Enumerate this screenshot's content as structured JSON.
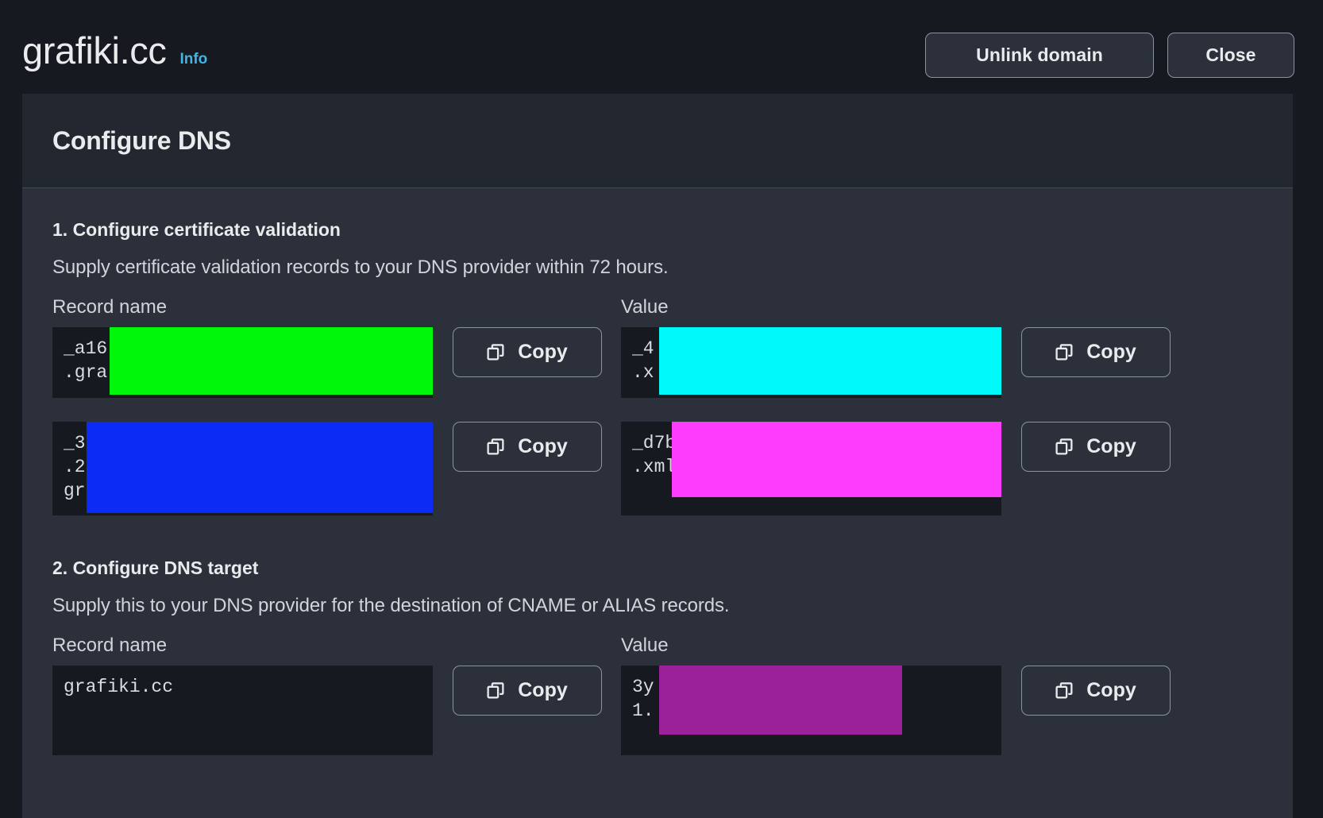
{
  "header": {
    "title": "grafiki.cc",
    "info_label": "Info",
    "unlink_label": "Unlink domain",
    "close_label": "Close"
  },
  "panel": {
    "title": "Configure DNS"
  },
  "labels": {
    "record_name": "Record name",
    "value": "Value",
    "copy": "Copy"
  },
  "colors": {
    "accent_link": "#42b4e6",
    "panel_bg": "#2b303b",
    "panel_header_bg": "#23272f",
    "page_bg": "#16191f",
    "field_bg": "#16191f",
    "button_border": "#8b949e",
    "text": "#e9ebed",
    "redact_green": "#00f707",
    "redact_blue": "#0b2cf5",
    "redact_cyan": "#00f9f9",
    "redact_magenta": "#fd3cfd",
    "redact_purple": "#9a2199"
  },
  "sections": [
    {
      "title": "1. Configure certificate validation",
      "description": "Supply certificate validation records to your DNS provider within 72 hours.",
      "rows": [
        {
          "record_name": "_a16\n.gra",
          "record_name_redacted": true,
          "value": "_4\n.x",
          "value_redacted": true
        },
        {
          "record_name": "_3\n.2\ngr",
          "record_name_redacted": true,
          "value": "_d7b\n.xml",
          "value_redacted": true
        }
      ]
    },
    {
      "title": "2. Configure DNS target",
      "description": "Supply this to your DNS provider for the destination of CNAME or ALIAS records.",
      "rows": [
        {
          "record_name": "grafiki.cc",
          "record_name_redacted": false,
          "value": "3y\n1.",
          "value_redacted": true
        }
      ]
    }
  ]
}
